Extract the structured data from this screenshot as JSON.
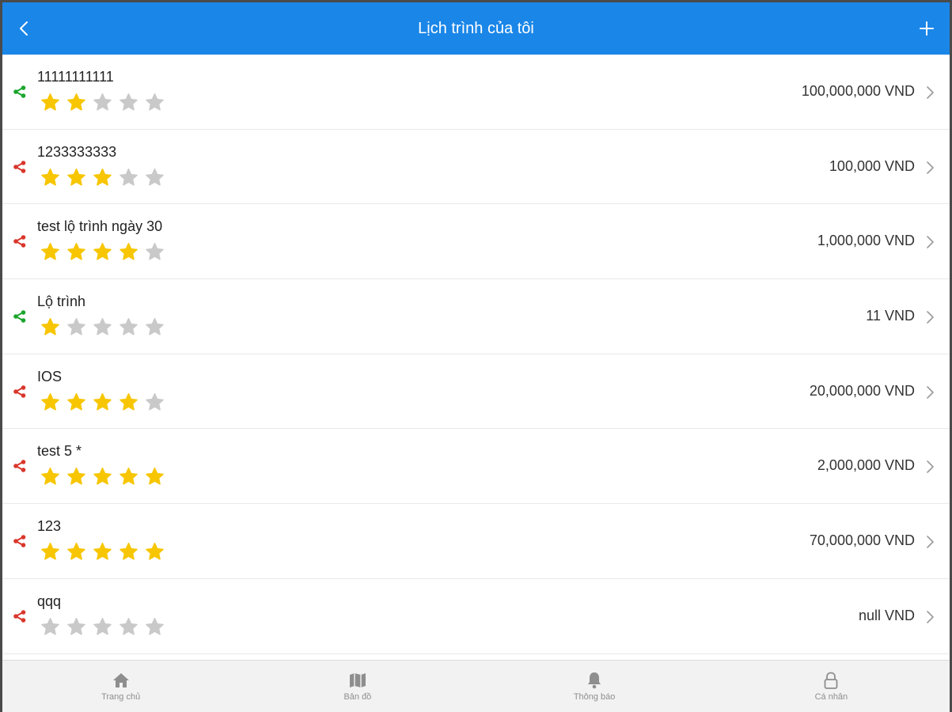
{
  "header": {
    "title": "Lịch trình của tôi",
    "back_icon": "chevron-left-icon",
    "add_icon": "plus-icon",
    "background": "#1a86e8"
  },
  "colors": {
    "star_filled": "#f7c600",
    "star_empty": "#c9c9c9",
    "share_green": "#1aa52c",
    "share_red": "#d9362b"
  },
  "trips": [
    {
      "name": "11111111111",
      "rating": 2,
      "price": "100,000,000 VND",
      "share_color": "green"
    },
    {
      "name": "1233333333",
      "rating": 3,
      "price": "100,000 VND",
      "share_color": "red"
    },
    {
      "name": "test lộ trình ngày 30",
      "rating": 4,
      "price": "1,000,000 VND",
      "share_color": "red"
    },
    {
      "name": "Lộ trình",
      "rating": 1,
      "price": "11 VND",
      "share_color": "green"
    },
    {
      "name": "IOS",
      "rating": 4,
      "price": "20,000,000 VND",
      "share_color": "red"
    },
    {
      "name": "test 5 *",
      "rating": 5,
      "price": "2,000,000 VND",
      "share_color": "red"
    },
    {
      "name": "123",
      "rating": 5,
      "price": "70,000,000 VND",
      "share_color": "red"
    },
    {
      "name": "qqq",
      "rating": 0,
      "price": "null VND",
      "share_color": "red"
    }
  ],
  "tabs": [
    {
      "label": "Trang chủ",
      "icon": "home-icon"
    },
    {
      "label": "Bản đồ",
      "icon": "map-icon"
    },
    {
      "label": "Thông báo",
      "icon": "bell-icon"
    },
    {
      "label": "Cá nhân",
      "icon": "lock-icon"
    }
  ]
}
